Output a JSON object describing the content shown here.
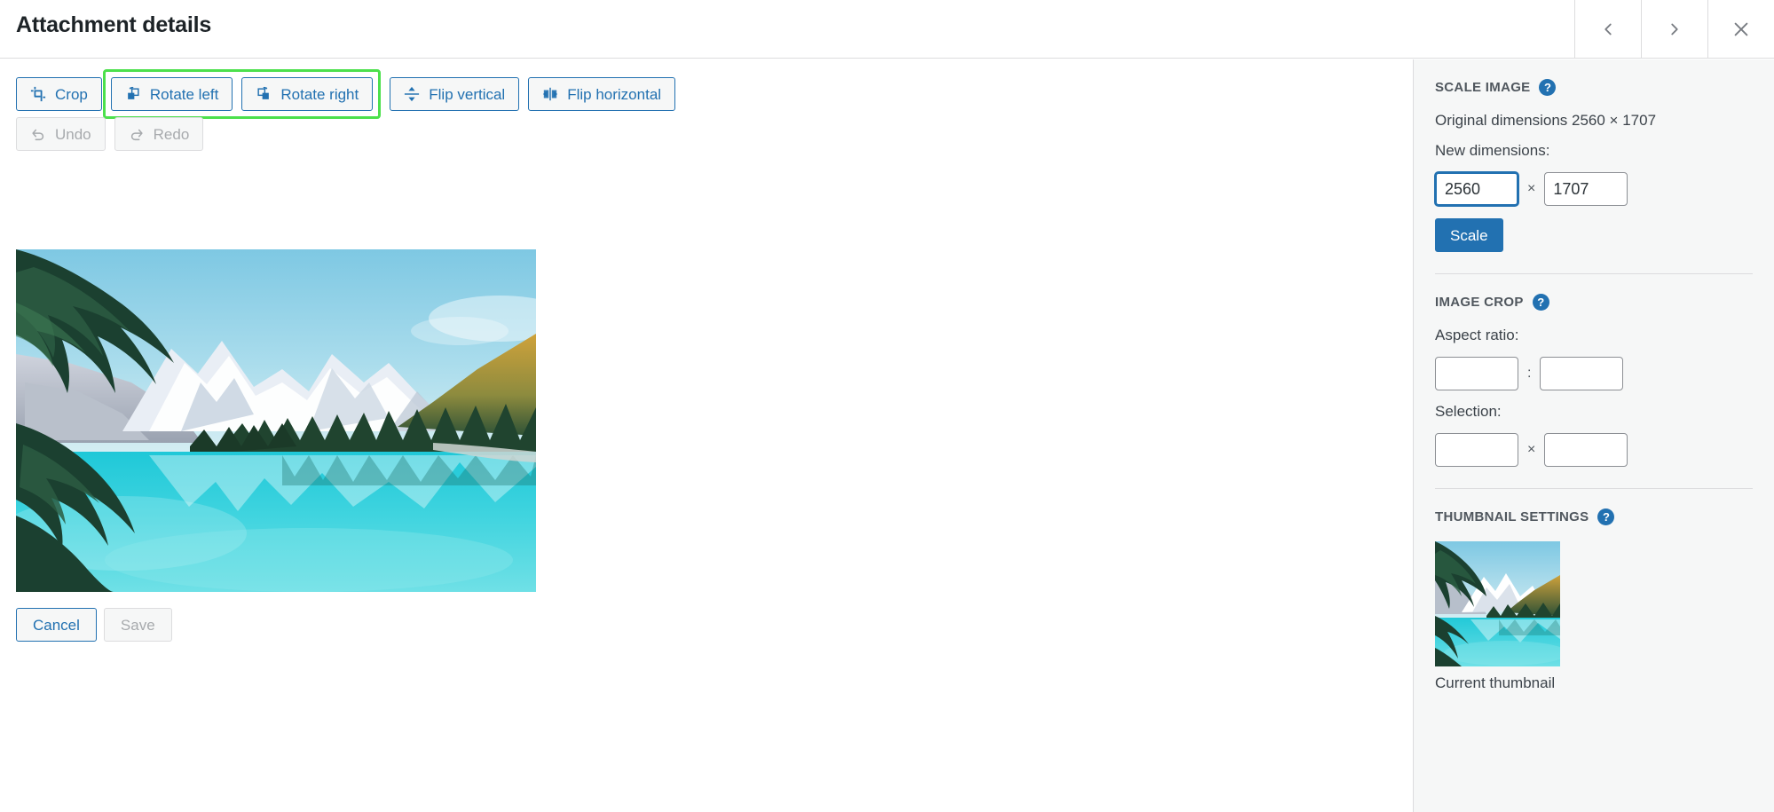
{
  "header": {
    "title": "Attachment details",
    "prev_label": "Previous",
    "next_label": "Next",
    "close_label": "Close"
  },
  "toolbar": {
    "row1": [
      {
        "id": "crop",
        "label": "Crop",
        "icon": "crop-icon",
        "disabled": false,
        "highlighted": false
      },
      {
        "id": "rotate-left",
        "label": "Rotate left",
        "icon": "rotate-left-icon",
        "disabled": false,
        "highlighted": true
      },
      {
        "id": "rotate-right",
        "label": "Rotate right",
        "icon": "rotate-right-icon",
        "disabled": false,
        "highlighted": true
      },
      {
        "id": "flip-vertical",
        "label": "Flip vertical",
        "icon": "flip-vertical-icon",
        "disabled": false,
        "highlighted": false
      },
      {
        "id": "flip-horizontal",
        "label": "Flip horizontal",
        "icon": "flip-horizontal-icon",
        "disabled": false,
        "highlighted": false
      }
    ],
    "row2": [
      {
        "id": "undo",
        "label": "Undo",
        "icon": "undo-icon",
        "disabled": true
      },
      {
        "id": "redo",
        "label": "Redo",
        "icon": "redo-icon",
        "disabled": true
      }
    ],
    "highlight_color": "#4ce04c"
  },
  "image": {
    "alt": "Moraine Lake turquoise lake with snow-capped mountains and evergreen forest"
  },
  "actions": {
    "cancel_label": "Cancel",
    "save_label": "Save",
    "save_disabled": true
  },
  "sidebar": {
    "scale": {
      "title": "Scale Image",
      "help": "?",
      "original_dimensions_label": "Original dimensions 2560 × 1707",
      "new_dimensions_label": "New dimensions:",
      "width_value": "2560",
      "height_value": "1707",
      "separator": "×",
      "button_label": "Scale"
    },
    "crop": {
      "title": "Image Crop",
      "help": "?",
      "aspect_ratio_label": "Aspect ratio:",
      "aspect_w_value": "",
      "aspect_h_value": "",
      "aspect_separator": ":",
      "selection_label": "Selection:",
      "selection_w_value": "",
      "selection_h_value": "",
      "selection_separator": "×"
    },
    "thumbnail": {
      "title": "Thumbnail Settings",
      "help": "?",
      "caption": "Current thumbnail"
    }
  },
  "colors": {
    "accent": "#2271b1",
    "sidebar_bg": "#f6f7f7",
    "border": "#dcdcde",
    "highlight": "#4ce04c",
    "disabled_text": "#a7aaad"
  }
}
